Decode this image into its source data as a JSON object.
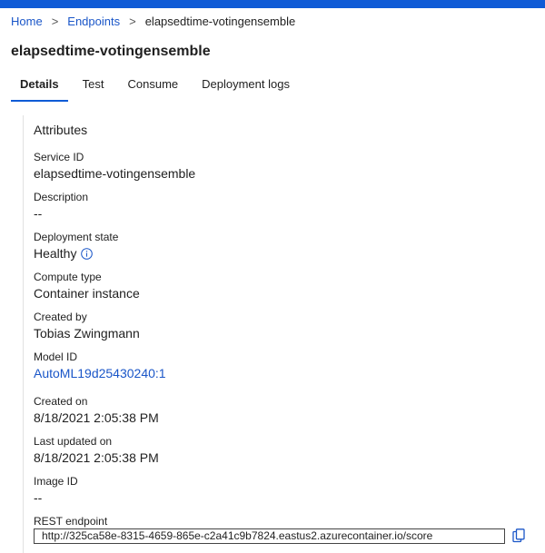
{
  "breadcrumb": {
    "home": "Home",
    "endpoints": "Endpoints",
    "current": "elapsedtime-votingensemble",
    "separator": ">"
  },
  "page_title": "elapsedtime-votingensemble",
  "tabs": [
    {
      "label": "Details",
      "active": true
    },
    {
      "label": "Test",
      "active": false
    },
    {
      "label": "Consume",
      "active": false
    },
    {
      "label": "Deployment logs",
      "active": false
    }
  ],
  "attributes": {
    "section_title": "Attributes",
    "service_id": {
      "label": "Service ID",
      "value": "elapsedtime-votingensemble"
    },
    "description": {
      "label": "Description",
      "value": "--"
    },
    "deployment_state": {
      "label": "Deployment state",
      "value": "Healthy",
      "icon": "info-icon"
    },
    "compute_type": {
      "label": "Compute type",
      "value": "Container instance"
    },
    "created_by": {
      "label": "Created by",
      "value": "Tobias Zwingmann"
    },
    "model_id": {
      "label": "Model ID",
      "value": "AutoML19d25430240:1"
    },
    "created_on": {
      "label": "Created on",
      "value": "8/18/2021 2:05:38 PM"
    },
    "last_updated_on": {
      "label": "Last updated on",
      "value": "8/18/2021 2:05:38 PM"
    },
    "image_id": {
      "label": "Image ID",
      "value": "--"
    },
    "rest_endpoint": {
      "label": "REST endpoint",
      "value": "http://325ca58e-8315-4659-865e-c2a41c9b7824.eastus2.azurecontainer.io/score",
      "icon": "copy-icon"
    }
  },
  "colors": {
    "accent": "#0f5bd6",
    "link": "#1a56c8"
  }
}
